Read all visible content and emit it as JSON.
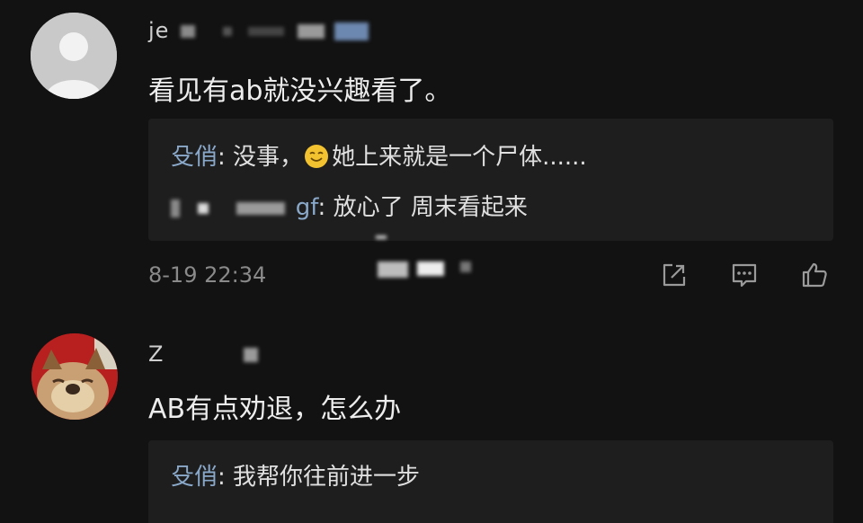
{
  "comments": [
    {
      "username_visible": "je",
      "text": "看见有ab就没兴趣看了。",
      "replies": [
        {
          "name": "殳俏",
          "separator": ": ",
          "text_before_emoji": "没事，",
          "text_after_emoji": "她上来就是一个尸体......"
        },
        {
          "name_visible_suffix": "gf",
          "separator": ": ",
          "text": "放心了  周末看起来"
        }
      ],
      "timestamp": "8-19 22:34",
      "actions": [
        "share-icon",
        "comment-icon",
        "like-icon"
      ]
    },
    {
      "username_visible": "Z",
      "text": "AB有点劝退，怎么办",
      "replies": [
        {
          "name": "殳俏",
          "separator": ": ",
          "text": "我帮你往前进一步"
        }
      ]
    }
  ],
  "colors": {
    "background": "#121212",
    "reply_background": "#1e1e1e",
    "reply_name": "#8aa8c9",
    "meta": "#8a8a8a"
  }
}
